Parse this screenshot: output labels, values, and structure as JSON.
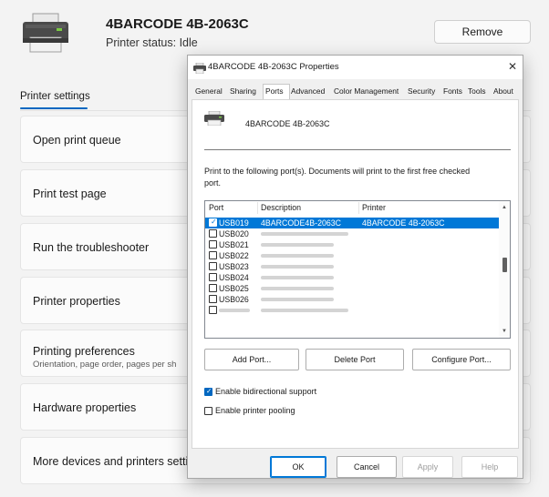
{
  "settings_page": {
    "printer_title": "4BARCODE 4B-2063C",
    "printer_status": "Printer status:  Idle",
    "remove_label": "Remove",
    "tab_label": "Printer settings",
    "cards": [
      {
        "label": "Open print queue"
      },
      {
        "label": "Print test page"
      },
      {
        "label": "Run the troubleshooter"
      },
      {
        "label": "Printer properties"
      },
      {
        "label": "Printing preferences",
        "sub": "Orientation, page order, pages per sh"
      },
      {
        "label": "Hardware properties"
      },
      {
        "label": "More devices and printers setting"
      }
    ]
  },
  "dialog": {
    "title": "4BARCODE 4B-2063C Properties",
    "close_glyph": "✕",
    "tabs": [
      "General",
      "Sharing",
      "Ports",
      "Advanced",
      "Color Management",
      "Security",
      "Fonts",
      "Tools",
      "About"
    ],
    "active_tab": "Ports",
    "printer_name": "4BARCODE 4B-2063C",
    "instructions": "Print to the following port(s). Documents will print to the first free checked port.",
    "columns": {
      "port": "Port",
      "description": "Description",
      "printer": "Printer"
    },
    "rows": [
      {
        "port": "USB019",
        "description": "4BARCODE4B-2063C",
        "printer": "4BARCODE 4B-2063C",
        "checked": true,
        "selected": true
      },
      {
        "port": "USB020",
        "checked": false
      },
      {
        "port": "USB021",
        "checked": false
      },
      {
        "port": "USB022",
        "checked": false
      },
      {
        "port": "USB023",
        "checked": false
      },
      {
        "port": "USB024",
        "checked": false
      },
      {
        "port": "USB025",
        "checked": false
      },
      {
        "port": "USB026",
        "checked": false
      }
    ],
    "port_buttons": {
      "add": "Add Port...",
      "delete": "Delete Port",
      "configure": "Configure Port..."
    },
    "options": {
      "bidirectional": {
        "label": "Enable bidirectional support",
        "checked": true
      },
      "pooling": {
        "label": "Enable printer pooling",
        "checked": false
      }
    },
    "footer_buttons": {
      "ok": "OK",
      "cancel": "Cancel",
      "apply": "Apply",
      "help": "Help"
    }
  },
  "colors": {
    "accent": "#0067c0",
    "selection": "#0078d7"
  },
  "icons": [
    "printer-icon",
    "close-icon",
    "checkbox-icon",
    "scroll-up-icon",
    "scroll-down-icon"
  ]
}
